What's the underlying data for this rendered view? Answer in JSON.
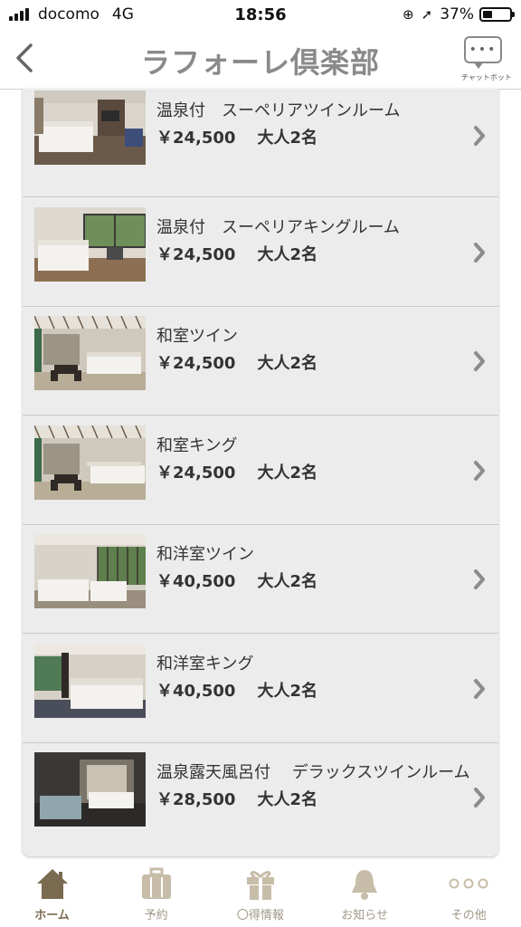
{
  "status": {
    "carrier": "docomo",
    "network": "4G",
    "time": "18:56",
    "battery_text": "37%",
    "battery_level": 0.37
  },
  "nav": {
    "title": "ラフォーレ倶楽部",
    "chat_label": "チャットボット",
    "chat_dots": "•••"
  },
  "rooms": [
    {
      "name": "温泉付　スーペリアツインルーム",
      "price": "￥24,500",
      "guests": "大人2名",
      "thumb_style": "western-twin"
    },
    {
      "name": "温泉付　スーペリアキングルーム",
      "price": "￥24,500",
      "guests": "大人2名",
      "thumb_style": "western-king"
    },
    {
      "name": "和室ツイン",
      "price": "￥24,500",
      "guests": "大人2名",
      "thumb_style": "japanese-twin"
    },
    {
      "name": "和室キング",
      "price": "￥24,500",
      "guests": "大人2名",
      "thumb_style": "japanese-king"
    },
    {
      "name": "和洋室ツイン",
      "price": "￥40,500",
      "guests": "大人2名",
      "thumb_style": "wayo-twin"
    },
    {
      "name": "和洋室キング",
      "price": "￥40,500",
      "guests": "大人2名",
      "thumb_style": "wayo-king"
    },
    {
      "name": "温泉露天風呂付　 デラックスツインルーム",
      "price": "￥28,500",
      "guests": "大人2名",
      "thumb_style": "bath"
    }
  ],
  "tabs": [
    {
      "label": "ホーム",
      "icon": "home-icon",
      "active": true
    },
    {
      "label": "予約",
      "icon": "suitcase-icon",
      "active": false
    },
    {
      "label": "〇得情報",
      "icon": "gift-icon",
      "active": false
    },
    {
      "label": "お知らせ",
      "icon": "bell-icon",
      "active": false
    },
    {
      "label": "その他",
      "icon": "more-icon",
      "active": false
    }
  ],
  "colors": {
    "tab_active": "#7a6a50",
    "tab_inactive": "#c7bda9",
    "list_bg": "#ececec",
    "chevron": "#8c8c8c"
  }
}
